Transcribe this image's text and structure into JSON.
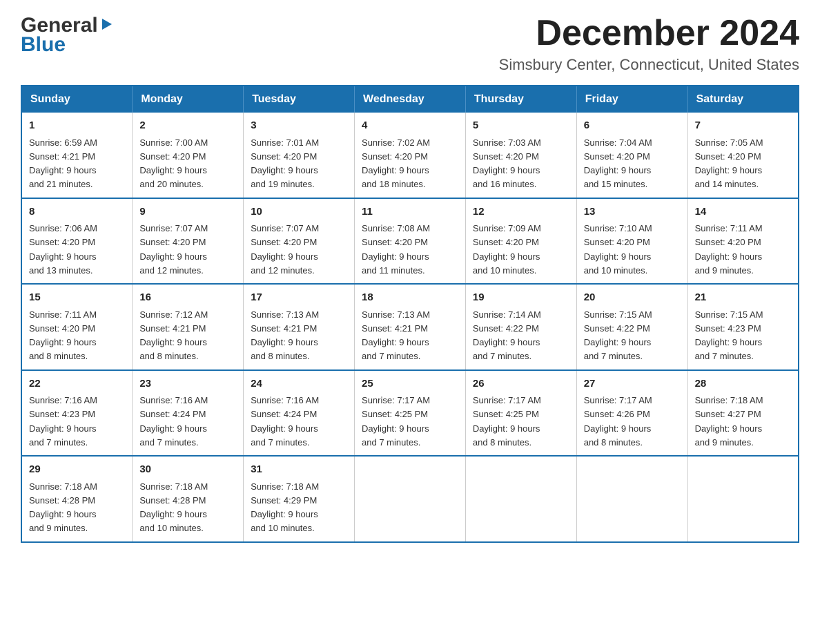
{
  "header": {
    "logo_general": "General",
    "logo_blue": "Blue",
    "month_title": "December 2024",
    "location": "Simsbury Center, Connecticut, United States"
  },
  "weekdays": [
    "Sunday",
    "Monday",
    "Tuesday",
    "Wednesday",
    "Thursday",
    "Friday",
    "Saturday"
  ],
  "weeks": [
    [
      {
        "day": "1",
        "sunrise": "6:59 AM",
        "sunset": "4:21 PM",
        "daylight": "9 hours and 21 minutes."
      },
      {
        "day": "2",
        "sunrise": "7:00 AM",
        "sunset": "4:20 PM",
        "daylight": "9 hours and 20 minutes."
      },
      {
        "day": "3",
        "sunrise": "7:01 AM",
        "sunset": "4:20 PM",
        "daylight": "9 hours and 19 minutes."
      },
      {
        "day": "4",
        "sunrise": "7:02 AM",
        "sunset": "4:20 PM",
        "daylight": "9 hours and 18 minutes."
      },
      {
        "day": "5",
        "sunrise": "7:03 AM",
        "sunset": "4:20 PM",
        "daylight": "9 hours and 16 minutes."
      },
      {
        "day": "6",
        "sunrise": "7:04 AM",
        "sunset": "4:20 PM",
        "daylight": "9 hours and 15 minutes."
      },
      {
        "day": "7",
        "sunrise": "7:05 AM",
        "sunset": "4:20 PM",
        "daylight": "9 hours and 14 minutes."
      }
    ],
    [
      {
        "day": "8",
        "sunrise": "7:06 AM",
        "sunset": "4:20 PM",
        "daylight": "9 hours and 13 minutes."
      },
      {
        "day": "9",
        "sunrise": "7:07 AM",
        "sunset": "4:20 PM",
        "daylight": "9 hours and 12 minutes."
      },
      {
        "day": "10",
        "sunrise": "7:07 AM",
        "sunset": "4:20 PM",
        "daylight": "9 hours and 12 minutes."
      },
      {
        "day": "11",
        "sunrise": "7:08 AM",
        "sunset": "4:20 PM",
        "daylight": "9 hours and 11 minutes."
      },
      {
        "day": "12",
        "sunrise": "7:09 AM",
        "sunset": "4:20 PM",
        "daylight": "9 hours and 10 minutes."
      },
      {
        "day": "13",
        "sunrise": "7:10 AM",
        "sunset": "4:20 PM",
        "daylight": "9 hours and 10 minutes."
      },
      {
        "day": "14",
        "sunrise": "7:11 AM",
        "sunset": "4:20 PM",
        "daylight": "9 hours and 9 minutes."
      }
    ],
    [
      {
        "day": "15",
        "sunrise": "7:11 AM",
        "sunset": "4:20 PM",
        "daylight": "9 hours and 8 minutes."
      },
      {
        "day": "16",
        "sunrise": "7:12 AM",
        "sunset": "4:21 PM",
        "daylight": "9 hours and 8 minutes."
      },
      {
        "day": "17",
        "sunrise": "7:13 AM",
        "sunset": "4:21 PM",
        "daylight": "9 hours and 8 minutes."
      },
      {
        "day": "18",
        "sunrise": "7:13 AM",
        "sunset": "4:21 PM",
        "daylight": "9 hours and 7 minutes."
      },
      {
        "day": "19",
        "sunrise": "7:14 AM",
        "sunset": "4:22 PM",
        "daylight": "9 hours and 7 minutes."
      },
      {
        "day": "20",
        "sunrise": "7:15 AM",
        "sunset": "4:22 PM",
        "daylight": "9 hours and 7 minutes."
      },
      {
        "day": "21",
        "sunrise": "7:15 AM",
        "sunset": "4:23 PM",
        "daylight": "9 hours and 7 minutes."
      }
    ],
    [
      {
        "day": "22",
        "sunrise": "7:16 AM",
        "sunset": "4:23 PM",
        "daylight": "9 hours and 7 minutes."
      },
      {
        "day": "23",
        "sunrise": "7:16 AM",
        "sunset": "4:24 PM",
        "daylight": "9 hours and 7 minutes."
      },
      {
        "day": "24",
        "sunrise": "7:16 AM",
        "sunset": "4:24 PM",
        "daylight": "9 hours and 7 minutes."
      },
      {
        "day": "25",
        "sunrise": "7:17 AM",
        "sunset": "4:25 PM",
        "daylight": "9 hours and 7 minutes."
      },
      {
        "day": "26",
        "sunrise": "7:17 AM",
        "sunset": "4:25 PM",
        "daylight": "9 hours and 8 minutes."
      },
      {
        "day": "27",
        "sunrise": "7:17 AM",
        "sunset": "4:26 PM",
        "daylight": "9 hours and 8 minutes."
      },
      {
        "day": "28",
        "sunrise": "7:18 AM",
        "sunset": "4:27 PM",
        "daylight": "9 hours and 9 minutes."
      }
    ],
    [
      {
        "day": "29",
        "sunrise": "7:18 AM",
        "sunset": "4:28 PM",
        "daylight": "9 hours and 9 minutes."
      },
      {
        "day": "30",
        "sunrise": "7:18 AM",
        "sunset": "4:28 PM",
        "daylight": "9 hours and 10 minutes."
      },
      {
        "day": "31",
        "sunrise": "7:18 AM",
        "sunset": "4:29 PM",
        "daylight": "9 hours and 10 minutes."
      },
      null,
      null,
      null,
      null
    ]
  ],
  "labels": {
    "sunrise": "Sunrise:",
    "sunset": "Sunset:",
    "daylight": "Daylight:"
  }
}
